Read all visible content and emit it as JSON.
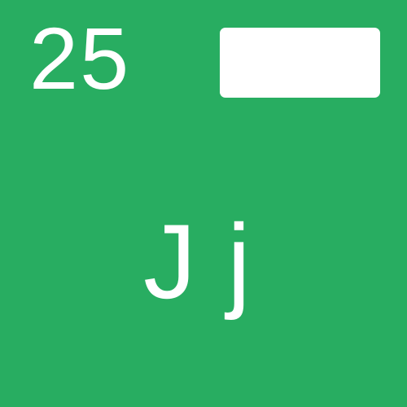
{
  "card": {
    "number": "25",
    "letters": "Jj",
    "colors": {
      "background": "#28ad61",
      "foreground": "#ffffff"
    }
  }
}
